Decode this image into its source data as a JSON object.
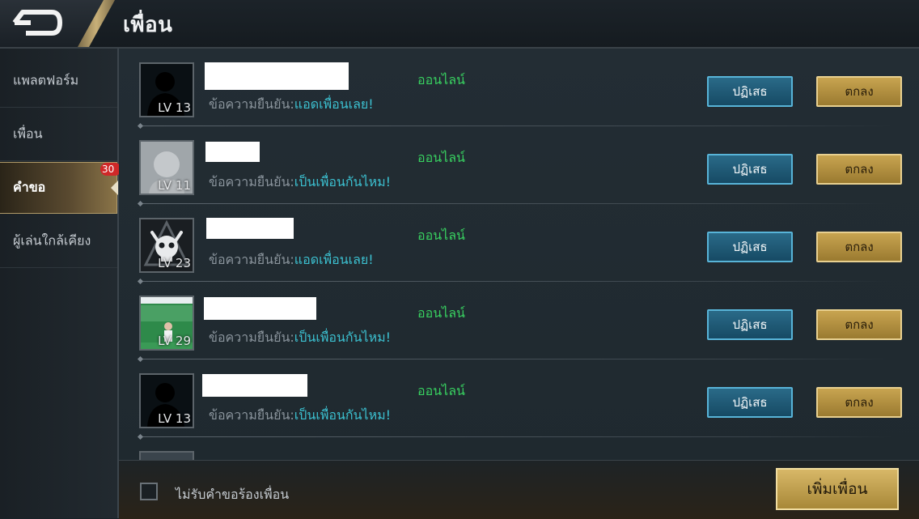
{
  "header": {
    "title": "เพื่อน"
  },
  "sidebar": {
    "items": [
      {
        "label": "แพลตฟอร์ม"
      },
      {
        "label": "เพื่อน"
      },
      {
        "label": "คำขอ",
        "badge": "30"
      },
      {
        "label": "ผู้เล่นใกล้เคียง"
      }
    ]
  },
  "requests": [
    {
      "level": "LV 13",
      "status": "ออนไลน์",
      "msg_prefix": "ข้อความยืนยัน:",
      "msg_value": "แอดเพื่อนเลย!",
      "reject": "ปฏิเสธ",
      "accept": "ตกลง",
      "avatar": "silhouette-icon"
    },
    {
      "level": "LV 11",
      "status": "ออนไลน์",
      "msg_prefix": "ข้อความยืนยัน:",
      "msg_value": "เป็นเพื่อนกันไหม!",
      "reject": "ปฏิเสธ",
      "accept": "ตกลง",
      "avatar": "default-avatar-icon"
    },
    {
      "level": "LV 23",
      "status": "ออนไลน์",
      "msg_prefix": "ข้อความยืนยัน:",
      "msg_value": "แอดเพื่อนเลย!",
      "reject": "ปฏิเสธ",
      "accept": "ตกลง",
      "avatar": "skull-emblem-icon"
    },
    {
      "level": "LV 29",
      "status": "ออนไลน์",
      "msg_prefix": "ข้อความยืนยัน:",
      "msg_value": "เป็นเพื่อนกันไหม!",
      "reject": "ปฏิเสธ",
      "accept": "ตกลง",
      "avatar": "photo-avatar"
    },
    {
      "level": "LV 13",
      "status": "ออนไลน์",
      "msg_prefix": "ข้อความยืนยัน:",
      "msg_value": "เป็นเพื่อนกันไหม!",
      "reject": "ปฏิเสธ",
      "accept": "ตกลง",
      "avatar": "silhouette-icon"
    }
  ],
  "footer": {
    "checkbox_label": "ไม่รับคำขอร้องเพื่อน",
    "add_friend": "เพิ่มเพื่อน"
  },
  "colors": {
    "online": "#38d060",
    "message_value": "#3cc0d0",
    "gold": "#c8a450",
    "blue": "#2a6a88"
  }
}
